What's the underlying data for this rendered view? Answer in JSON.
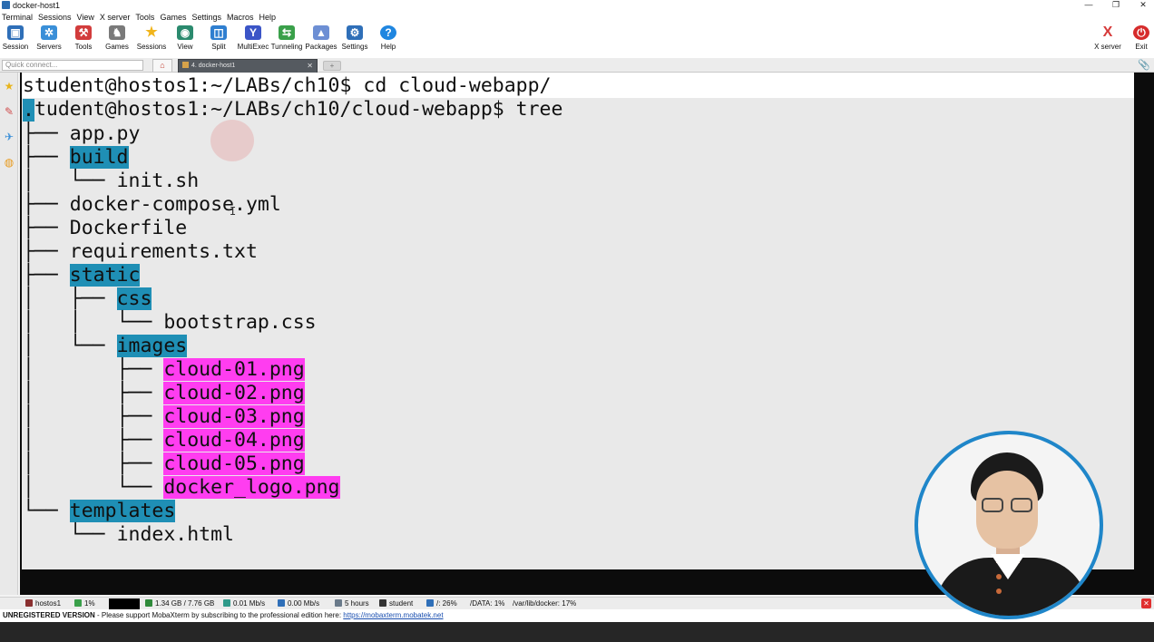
{
  "window": {
    "title": "docker-host1",
    "minimize": "—",
    "maximize": "❐",
    "close": "✕"
  },
  "menu": [
    "Terminal",
    "Sessions",
    "View",
    "X server",
    "Tools",
    "Games",
    "Settings",
    "Macros",
    "Help"
  ],
  "toolbar": {
    "items": [
      {
        "label": "Session",
        "icon": "session-icon",
        "color": "#2f6fb8"
      },
      {
        "label": "Servers",
        "icon": "servers-icon",
        "color": "#3a8fd8"
      },
      {
        "label": "Tools",
        "icon": "tools-icon",
        "color": "#d23c3c"
      },
      {
        "label": "Games",
        "icon": "games-icon",
        "color": "#7a7a7a"
      },
      {
        "label": "Sessions",
        "icon": "star-icon",
        "color": "#f1b51c"
      },
      {
        "label": "View",
        "icon": "view-icon",
        "color": "#2b8a6e"
      },
      {
        "label": "Split",
        "icon": "split-icon",
        "color": "#2f7fd0"
      },
      {
        "label": "MultiExec",
        "icon": "multiexec-icon",
        "color": "#3b55c7"
      },
      {
        "label": "Tunneling",
        "icon": "tunneling-icon",
        "color": "#3aa04a"
      },
      {
        "label": "Packages",
        "icon": "packages-icon",
        "color": "#6d8fd4"
      },
      {
        "label": "Settings",
        "icon": "gear-icon",
        "color": "#2f6fb8"
      },
      {
        "label": "Help",
        "icon": "help-icon",
        "color": "#1f86e0"
      }
    ],
    "xserver_label": "X server",
    "exit_label": "Exit"
  },
  "tabs": {
    "quick_connect_placeholder": "Quick connect...",
    "session_tab_label": "4. docker-host1",
    "tab_close": "✕"
  },
  "terminal": {
    "lines": [
      {
        "prefix": "student@hostos1:~/LABs/ch10$ cd cloud-webapp/",
        "name": "",
        "kind": "plain"
      },
      {
        "prefix": "student@hostos1:~/LABs/ch10/cloud-webapp$ tree",
        "name": "",
        "kind": "plain"
      },
      {
        "prefix": "",
        "name": ".",
        "kind": "dir"
      },
      {
        "prefix": "├── ",
        "name": "app.py",
        "kind": "file"
      },
      {
        "prefix": "├── ",
        "name": "build",
        "kind": "dir"
      },
      {
        "prefix": "│   └── ",
        "name": "init.sh",
        "kind": "file"
      },
      {
        "prefix": "├── ",
        "name": "docker-compose.yml",
        "kind": "file"
      },
      {
        "prefix": "├── ",
        "name": "Dockerfile",
        "kind": "file"
      },
      {
        "prefix": "├── ",
        "name": "requirements.txt",
        "kind": "file"
      },
      {
        "prefix": "├── ",
        "name": "static",
        "kind": "dir"
      },
      {
        "prefix": "│   ├── ",
        "name": "css",
        "kind": "dir"
      },
      {
        "prefix": "│   │   └── ",
        "name": "bootstrap.css",
        "kind": "file"
      },
      {
        "prefix": "│   └── ",
        "name": "images",
        "kind": "dir"
      },
      {
        "prefix": "│       ├── ",
        "name": "cloud-01.png",
        "kind": "img"
      },
      {
        "prefix": "│       ├── ",
        "name": "cloud-02.png",
        "kind": "img"
      },
      {
        "prefix": "│       ├── ",
        "name": "cloud-03.png",
        "kind": "img"
      },
      {
        "prefix": "│       ├── ",
        "name": "cloud-04.png",
        "kind": "img"
      },
      {
        "prefix": "│       ├── ",
        "name": "cloud-05.png",
        "kind": "img"
      },
      {
        "prefix": "│       └── ",
        "name": "docker_logo.png",
        "kind": "img"
      },
      {
        "prefix": "└── ",
        "name": "templates",
        "kind": "dir"
      },
      {
        "prefix": "    └── ",
        "name": "index.html",
        "kind": "file"
      }
    ],
    "colors": {
      "dir_highlight": "#1f8fb5",
      "image_highlight": "#ff3df0",
      "background": "#e9e9e9"
    }
  },
  "status": {
    "host": "hostos1",
    "cpu": "1%",
    "memory": "1.34 GB / 7.76 GB",
    "upload": "0.01 Mb/s",
    "download": "0.00 Mb/s",
    "uptime": "5 hours",
    "user": "student",
    "disk_root": "/: 26%",
    "disk_data": "/DATA: 1%",
    "disk_docker": "/var/lib/docker: 17%"
  },
  "footer": {
    "unregistered": "UNREGISTERED VERSION",
    "message": "  -  Please support MobaXterm by subscribing to the professional edition here:  ",
    "link": "https://mobaxterm.mobatek.net"
  }
}
